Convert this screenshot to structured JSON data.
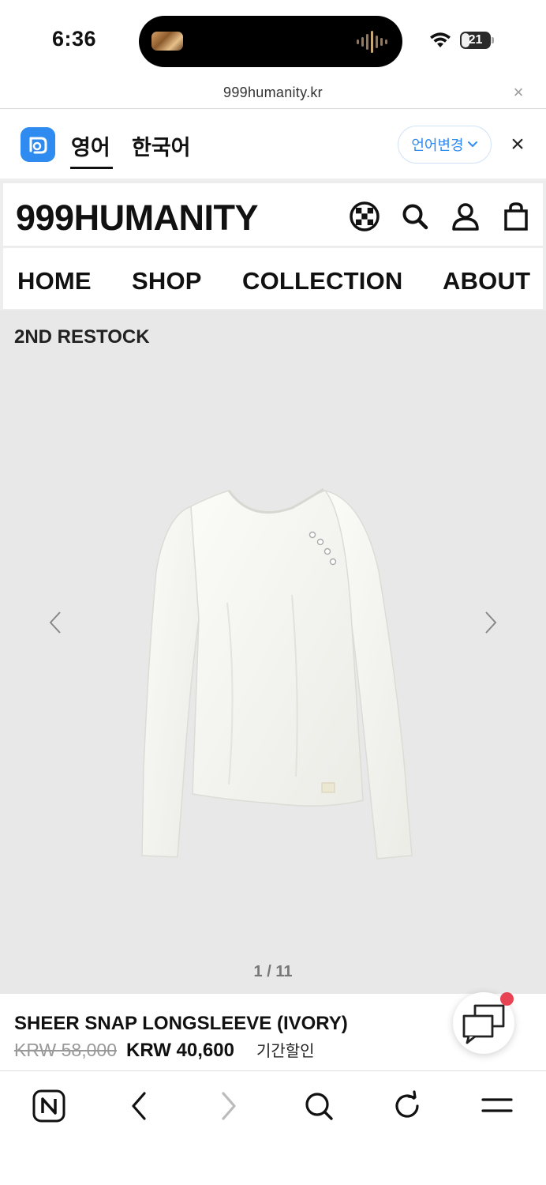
{
  "status_bar": {
    "time": "6:36",
    "battery": "21"
  },
  "url_bar": {
    "url": "999humanity.kr",
    "close": "×"
  },
  "translate_bar": {
    "lang_current": "영어",
    "lang_target": "한국어",
    "change_label": "언어변경",
    "close": "×"
  },
  "site": {
    "brand": "999HUMANITY",
    "nav": [
      "HOME",
      "SHOP",
      "COLLECTION",
      "ABOUT"
    ]
  },
  "gallery": {
    "badge": "2ND RESTOCK",
    "counter": "1 / 11"
  },
  "product": {
    "name": "SHEER SNAP LONGSLEEVE (IVORY)",
    "old_price": "KRW 58,000",
    "new_price": "KRW 40,600",
    "sale_label": "기간할인"
  },
  "colors": {
    "accent": "#2f8bf0",
    "notification": "#e84353",
    "gallery_bg": "#e8e8e8"
  },
  "icons": {
    "header": [
      "globe-icon",
      "search-icon",
      "account-icon",
      "cart-icon"
    ],
    "toolbar": [
      "naver-home-icon",
      "back-icon",
      "forward-icon",
      "search-icon",
      "reload-icon",
      "menu-icon"
    ]
  }
}
